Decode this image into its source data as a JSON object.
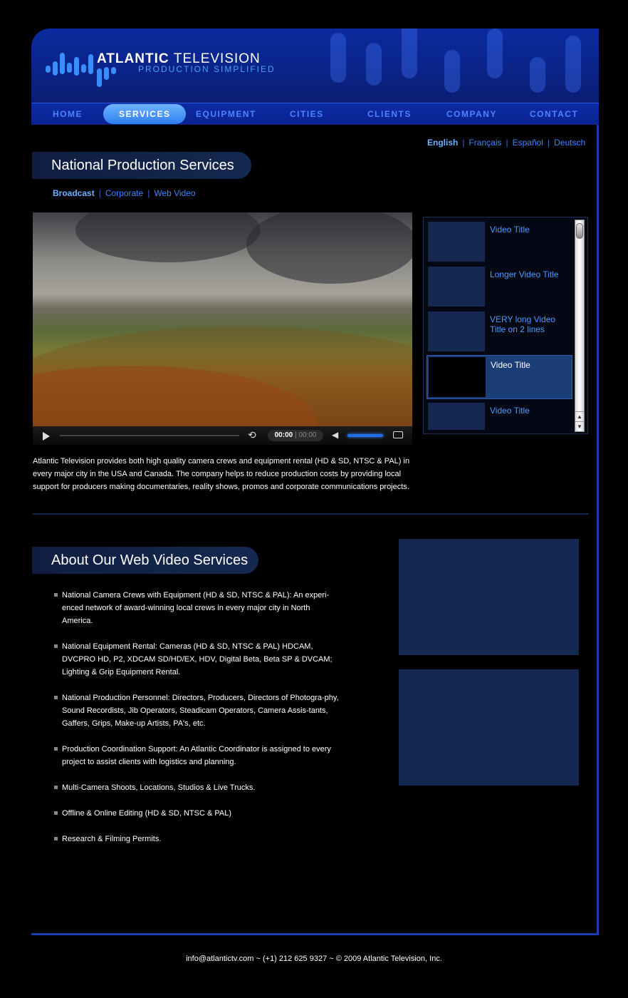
{
  "brand": {
    "name_bold": "ATLANTIC",
    "name_regular": "TELEVISION",
    "tagline": "PRODUCTION SIMPLIFIED",
    "accent": "#3b8cff"
  },
  "nav": {
    "items": [
      "HOME",
      "SERVICES",
      "EQUIPMENT",
      "CITIES",
      "CLIENTS",
      "COMPANY",
      "CONTACT"
    ],
    "active": "SERVICES"
  },
  "languages": [
    "English",
    "Français",
    "Español",
    "Deutsch"
  ],
  "current_language": "English",
  "section1": {
    "title": "National Production Services",
    "sub_tabs": [
      "Broadcast",
      "Corporate",
      "Web Video"
    ],
    "active_sub_tab": "Broadcast"
  },
  "player": {
    "time_current": "00:00",
    "time_total": "00:00",
    "icons": [
      "play-icon",
      "rewind-icon",
      "volume-icon",
      "fullscreen-icon"
    ]
  },
  "playlist": {
    "items": [
      "Video Title",
      "Longer Video Title",
      "VERY long Video Title on 2 lines",
      "Video Title",
      "Video Title"
    ],
    "active_index": 3
  },
  "intro_text": "Atlantic Television provides both high quality camera crews and equipment rental (HD & SD, NTSC & PAL) in every major city in the USA and Canada. The company helps to reduce production costs by providing local support for producers making documentaries, reality shows, promos and corporate communications projects.",
  "section2": {
    "title": "About Our Web Video Services",
    "bullets": [
      "National Camera Crews with Equipment (HD & SD, NTSC & PAL): An experi-enced network of award-winning local crews in every major city in North America.",
      "National Equipment Rental: Cameras (HD & SD, NTSC & PAL) HDCAM, DVCPRO HD, P2, XDCAM SD/HD/EX, HDV, Digital Beta, Beta SP & DVCAM; Lighting & Grip Equipment Rental.",
      "National Production Personnel: Directors, Producers, Directors of Photogra-phy, Sound Recordists, Jib Operators, Steadicam Operators, Camera Assis-tants, Gaffers, Grips, Make-up Artists, PA's, etc.",
      "Production Coordination Support: An Atlantic Coordinator is assigned to every project to assist clients with logistics and planning.",
      "Multi-Camera Shoots, Locations, Studios & Live Trucks.",
      "Offline & Online Editing (HD & SD, NTSC & PAL)",
      "Research & Filming Permits."
    ]
  },
  "footer": "info@atlantictv.com  ~  (+1) 212 625 9327  ~  © 2009 Atlantic Television, Inc."
}
